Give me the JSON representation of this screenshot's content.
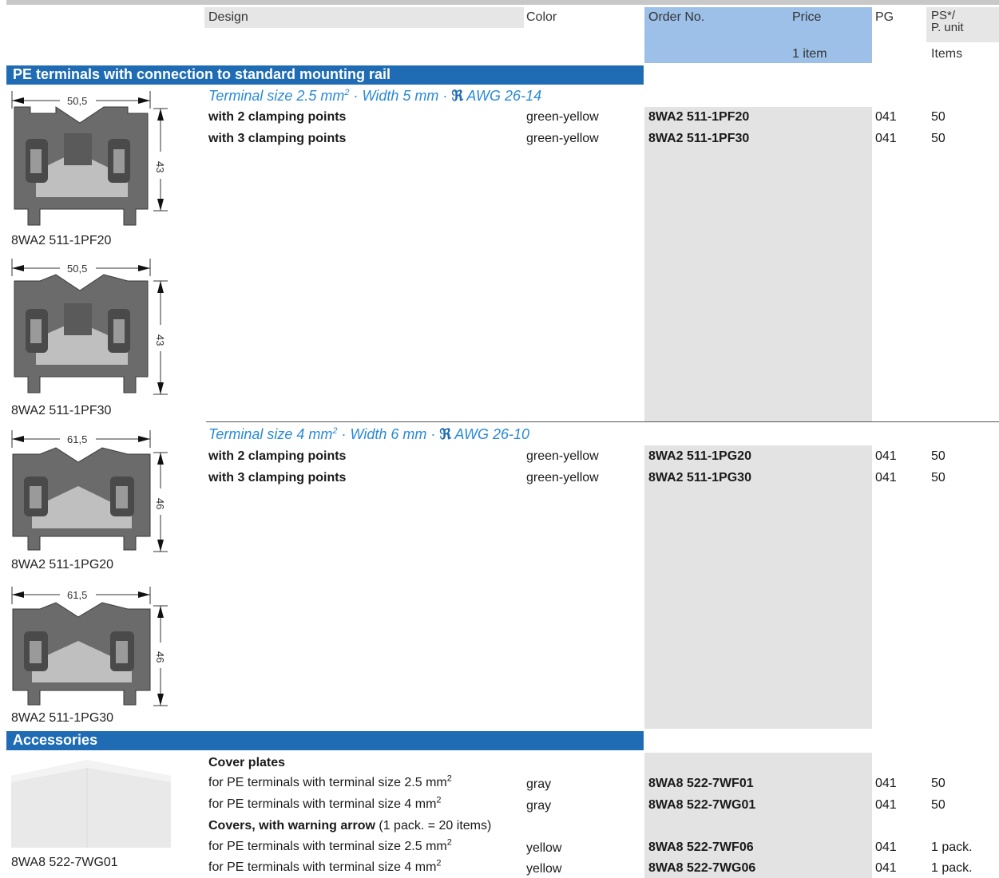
{
  "header": {
    "design": "Design",
    "color": "Color",
    "order_no": "Order No.",
    "price": "Price",
    "price_sub": "1 item",
    "pg": "PG",
    "ps_line1": "PS*/",
    "ps_line2": "P. unit",
    "ps_sub": "Items"
  },
  "section1": {
    "title": "PE terminals with connection to standard mounting rail",
    "group1": {
      "subhead_pre": "Terminal size 2.5 mm",
      "subhead_sup": "2",
      "subhead_post": " · Width 5 mm · ",
      "ul_mark": "ℜ",
      "awg": "AWG 26-14",
      "rows": [
        {
          "design": "with 2 clamping points",
          "color": "green-yellow",
          "order": "8WA2 511-1PF20",
          "pg": "041",
          "ps": "50"
        },
        {
          "design": "with 3 clamping points",
          "color": "green-yellow",
          "order": "8WA2 511-1PF30",
          "pg": "041",
          "ps": "50"
        }
      ],
      "figures": [
        {
          "caption": "8WA2 511-1PF20",
          "width_dim": "50,5",
          "height_dim": "43"
        },
        {
          "caption": "8WA2 511-1PF30",
          "width_dim": "50,5",
          "height_dim": "43"
        }
      ]
    },
    "group2": {
      "subhead_pre": "Terminal size 4 mm",
      "subhead_sup": "2",
      "subhead_post": " · Width 6 mm · ",
      "ul_mark": "ℜ",
      "awg": "AWG 26-10",
      "rows": [
        {
          "design": "with 2 clamping points",
          "color": "green-yellow",
          "order": "8WA2 511-1PG20",
          "pg": "041",
          "ps": "50"
        },
        {
          "design": "with 3 clamping points",
          "color": "green-yellow",
          "order": "8WA2 511-1PG30",
          "pg": "041",
          "ps": "50"
        }
      ],
      "figures": [
        {
          "caption": "8WA2 511-1PG20",
          "width_dim": "61,5",
          "height_dim": "46"
        },
        {
          "caption": "8WA2 511-1PG30",
          "width_dim": "61,5",
          "height_dim": "46"
        }
      ]
    }
  },
  "section2": {
    "title": "Accessories",
    "figure_caption": "8WA8 522-7WG01",
    "cover_plates_title": "Cover plates",
    "covers_title": "Covers, with warning arrow",
    "covers_note": " (1 pack. = 20 items)",
    "row_prefix": "for PE terminals with terminal size ",
    "rows": [
      {
        "size": "2.5 mm",
        "sup": "2",
        "color": "gray",
        "order": "8WA8 522-7WF01",
        "pg": "041",
        "ps": "50"
      },
      {
        "size": "4 mm",
        "sup": "2",
        "color": "gray",
        "order": "8WA8 522-7WG01",
        "pg": "041",
        "ps": "50"
      },
      {
        "size": "2.5 mm",
        "sup": "2",
        "color": "yellow",
        "order": "8WA8 522-7WF06",
        "pg": "041",
        "ps": "1 pack."
      },
      {
        "size": "4 mm",
        "sup": "2",
        "color": "yellow",
        "order": "8WA8 522-7WG06",
        "pg": "041",
        "ps": "1 pack."
      }
    ]
  }
}
